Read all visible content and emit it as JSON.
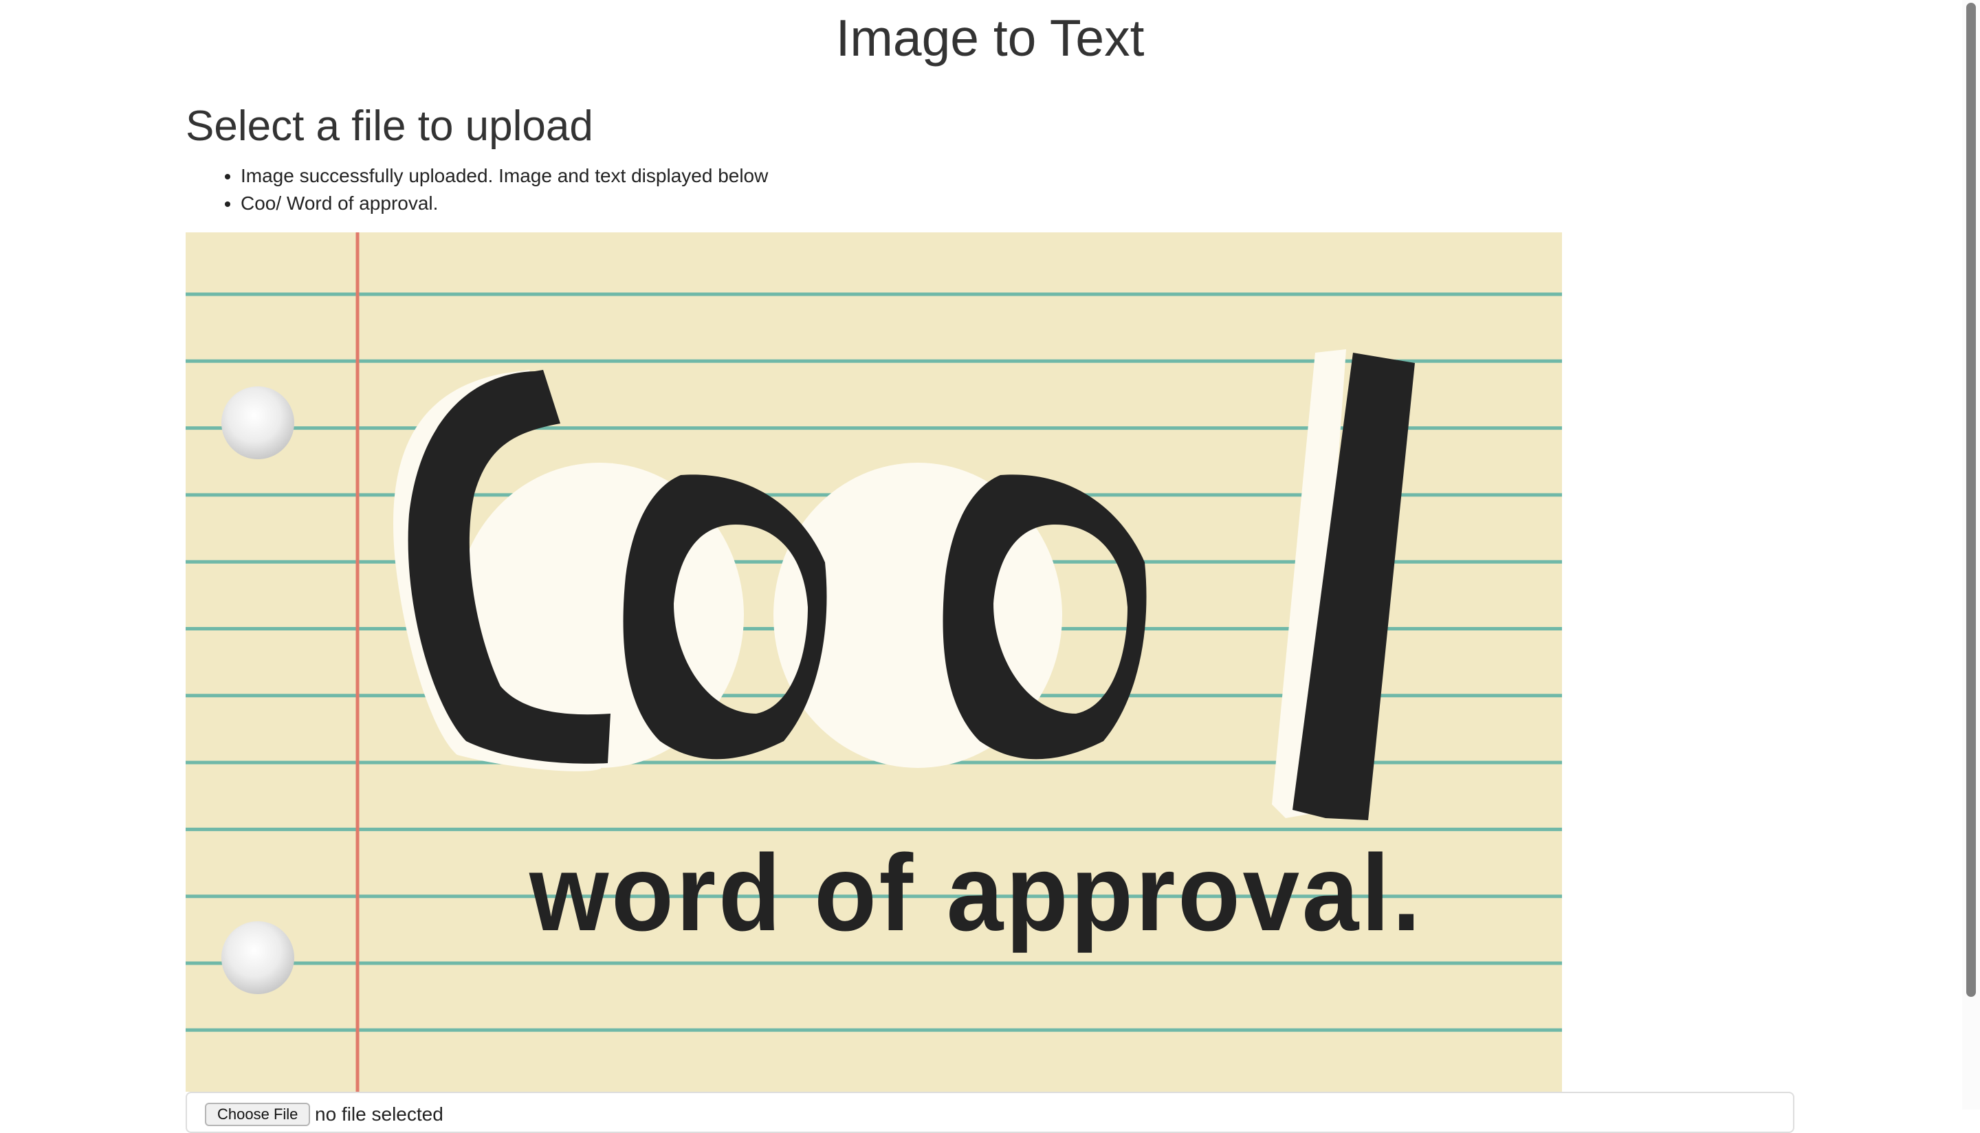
{
  "header": {
    "title": "Image to Text"
  },
  "upload_section": {
    "title": "Select a file to upload",
    "messages": [
      "Image successfully uploaded. Image and text displayed below",
      "Coo/ Word of approval."
    ]
  },
  "uploaded_image": {
    "big_word": "Cool",
    "caption": "word of approval."
  },
  "file_input": {
    "button_label": "Choose File",
    "status": "no file selected"
  },
  "colors": {
    "paper": "#f2e9c4",
    "rule_line": "#6fb8a8",
    "margin_line": "#e07a6a",
    "ink": "#232323",
    "text": "#333333"
  }
}
